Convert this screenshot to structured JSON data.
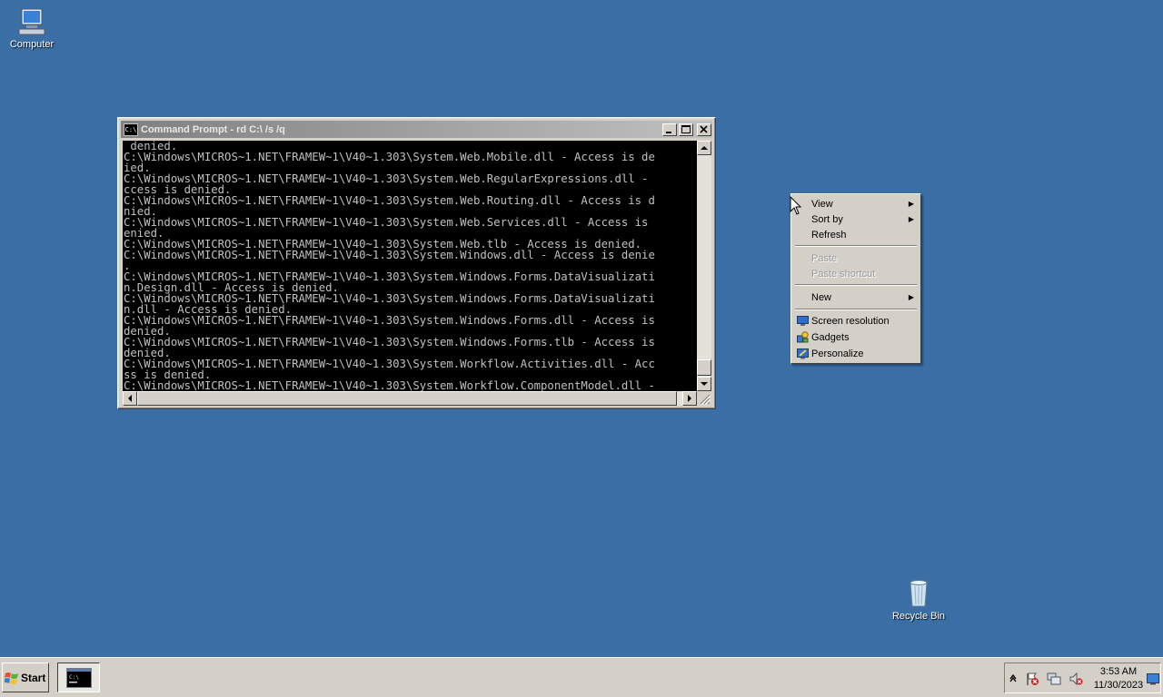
{
  "desktop": {
    "icons": [
      {
        "label": "Computer",
        "icon": "computer-icon"
      },
      {
        "label": "Recycle Bin",
        "icon": "recycle-bin-icon"
      }
    ],
    "background_color": "#3a6ea5"
  },
  "cmd_window": {
    "title": "Command Prompt - rd  C:\\ /s /q",
    "icon": "cmd-icon",
    "lines": [
      " denied.",
      "C:\\Windows\\MICROS~1.NET\\FRAMEW~1\\V40~1.303\\System.Web.Mobile.dll - Access is de",
      "ied.",
      "C:\\Windows\\MICROS~1.NET\\FRAMEW~1\\V40~1.303\\System.Web.RegularExpressions.dll -",
      "ccess is denied.",
      "C:\\Windows\\MICROS~1.NET\\FRAMEW~1\\V40~1.303\\System.Web.Routing.dll - Access is d",
      "nied.",
      "C:\\Windows\\MICROS~1.NET\\FRAMEW~1\\V40~1.303\\System.Web.Services.dll - Access is",
      "enied.",
      "C:\\Windows\\MICROS~1.NET\\FRAMEW~1\\V40~1.303\\System.Web.tlb - Access is denied.",
      "C:\\Windows\\MICROS~1.NET\\FRAMEW~1\\V40~1.303\\System.Windows.dll - Access is denie",
      ".",
      "C:\\Windows\\MICROS~1.NET\\FRAMEW~1\\V40~1.303\\System.Windows.Forms.DataVisualizati",
      "n.Design.dll - Access is denied.",
      "C:\\Windows\\MICROS~1.NET\\FRAMEW~1\\V40~1.303\\System.Windows.Forms.DataVisualizati",
      "n.dll - Access is denied.",
      "C:\\Windows\\MICROS~1.NET\\FRAMEW~1\\V40~1.303\\System.Windows.Forms.dll - Access is",
      "denied.",
      "C:\\Windows\\MICROS~1.NET\\FRAMEW~1\\V40~1.303\\System.Windows.Forms.tlb - Access is",
      "denied.",
      "C:\\Windows\\MICROS~1.NET\\FRAMEW~1\\V40~1.303\\System.Workflow.Activities.dll - Acc",
      "ss is denied.",
      "C:\\Windows\\MICROS~1.NET\\FRAMEW~1\\V40~1.303\\System.Workflow.ComponentModel.dll -"
    ],
    "console_bg": "#000000",
    "console_fg": "#c0c0c0"
  },
  "context_menu": {
    "items": [
      {
        "label": "View",
        "submenu": true
      },
      {
        "label": "Sort by",
        "submenu": true
      },
      {
        "label": "Refresh"
      },
      {
        "label": "Paste",
        "disabled": true
      },
      {
        "label": "Paste shortcut",
        "disabled": true
      },
      {
        "label": "New",
        "submenu": true
      },
      {
        "label": "Screen resolution",
        "icon": "screen-resolution-icon"
      },
      {
        "label": "Gadgets",
        "icon": "gadgets-icon"
      },
      {
        "label": "Personalize",
        "icon": "personalize-icon"
      }
    ]
  },
  "taskbar": {
    "start_label": "Start",
    "clock_time": "3:53 AM",
    "clock_date": "11/30/2023",
    "tray_icons": [
      "show-hidden-icons-chevron",
      "action-center-flag-icon",
      "network-icon",
      "volume-muted-icon",
      "show-desktop-icon"
    ]
  }
}
